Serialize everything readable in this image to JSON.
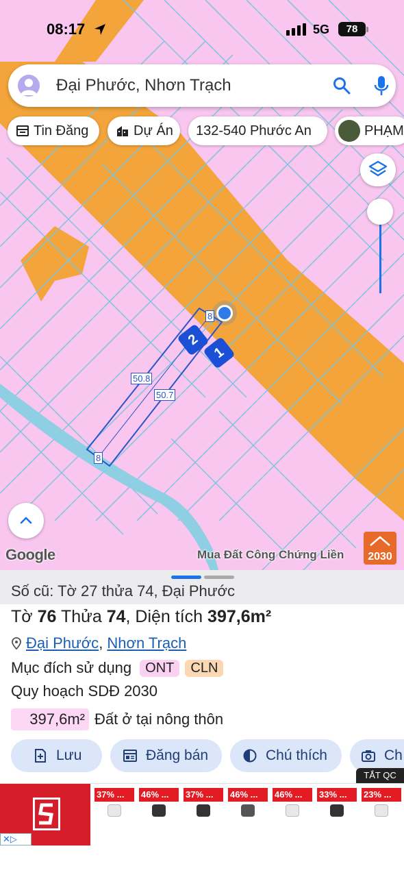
{
  "status_bar": {
    "time": "08:17",
    "network": "5G",
    "battery": "78"
  },
  "search": {
    "query": "Đại Phước, Nhơn Trạch"
  },
  "chips": [
    {
      "label": "Tin Đăng",
      "icon": "listing-icon"
    },
    {
      "label": "Dự Án",
      "icon": "building-icon"
    },
    {
      "label": "132-540 Phước An",
      "icon": ""
    },
    {
      "label": "PHẠM",
      "icon": "profile-photo-icon"
    }
  ],
  "map": {
    "measurements": {
      "top_edge": "8",
      "bottom_edge": "8",
      "left_edge": "50.8",
      "right_edge": "50.7"
    },
    "markers": [
      "2",
      "1"
    ],
    "attribution": "Google",
    "watermark": "Mua Đất Công Chứng Liền",
    "watermark_logo": "2030",
    "colors": {
      "residential": "#f8c6ef",
      "road": "#f3a53b",
      "plot_lines": "#7ec4de",
      "parcel": "#2a55c9",
      "river": "#8ecfe3"
    }
  },
  "sheet": {
    "old_info": "Số cũ: Tờ 27 thửa 74, Đại Phước",
    "title_prefix": "Tờ",
    "sheet_no": "76",
    "title_mid": "Thửa",
    "parcel_no": "74",
    "title_area_label": ", Diện tích",
    "area": "397,6m²",
    "address": {
      "ward": "Đại Phước",
      "separator": ", ",
      "district": "Nhơn Trạch"
    },
    "usage_label": "Mục đích sử dụng",
    "usage_tags": [
      {
        "code": "ONT",
        "color": "#fbd1f1"
      },
      {
        "code": "CLN",
        "color": "#fbd7b4"
      }
    ],
    "plan_label": "Quy hoạch SDĐ 2030",
    "land_use": {
      "area": "397,6m²",
      "type": "Đất ở tại nông thôn"
    }
  },
  "actions": [
    {
      "label": "Lưu",
      "icon": "bookmark-add-icon"
    },
    {
      "label": "Đăng bán",
      "icon": "newspaper-icon"
    },
    {
      "label": "Chú thích",
      "icon": "contrast-icon"
    },
    {
      "label": "Ch",
      "icon": "camera-icon"
    }
  ],
  "ad": {
    "close_label": "TẮT QC",
    "close_x": "✕▷",
    "discounts": [
      "37% ...",
      "46% ...",
      "37% ...",
      "46% ...",
      "46% ...",
      "33% ...",
      "23% ..."
    ]
  }
}
